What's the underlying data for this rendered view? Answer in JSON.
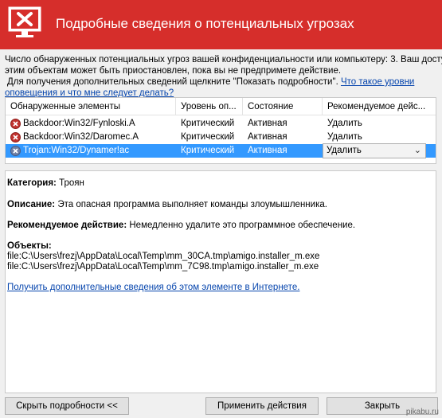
{
  "window": {
    "title": "Подробные сведения о потенциальных угрозах",
    "icon": "monitor-warning-icon",
    "accent_color": "#d62e2b"
  },
  "intro": {
    "line1": "Число обнаруженных потенциальных угроз вашей конфиденциальности или компьютеру: 3. Ваш доступ к",
    "line2": "этим объектам может быть приостановлен, пока вы не предпримете действие.",
    "line3": "Для получения дополнительных сведений щелкните \"Показать подробности\".",
    "link_part1": "Что такое уровни",
    "link_part2": "оповещения и что мне следует делать?"
  },
  "table": {
    "columns": [
      "Обнаруженные элементы",
      "Уровень оп...",
      "Состояние",
      "Рекомендуемое дейс..."
    ],
    "rows": [
      {
        "name": "Backdoor:Win32/Fynloski.A",
        "level": "Критический",
        "status": "Активная",
        "action": "Удалить",
        "selected": false
      },
      {
        "name": "Backdoor:Win32/Daromec.A",
        "level": "Критический",
        "status": "Активная",
        "action": "Удалить",
        "selected": false
      },
      {
        "name": "Trojan:Win32/Dynamer!ac",
        "level": "Критический",
        "status": "Активная",
        "action": "Удалить",
        "selected": true
      }
    ],
    "selection_color": "#3399ff"
  },
  "details": {
    "category_label": "Категория:",
    "category_value": "Троян",
    "description_label": "Описание:",
    "description_value": "Эта опасная программа выполняет команды злоумышленника.",
    "recommended_label": "Рекомендуемое действие:",
    "recommended_value": "Немедленно удалите это программное обеспечение.",
    "objects_label": "Объекты:",
    "objects": [
      "file:C:\\Users\\frezj\\AppData\\Local\\Temp\\mm_30CA.tmp\\amigo.installer_m.exe",
      "file:C:\\Users\\frezj\\AppData\\Local\\Temp\\mm_7C98.tmp\\amigo.installer_m.exe"
    ],
    "more_info_link": "Получить дополнительные сведения об этом элементе в Интернете."
  },
  "footer": {
    "hide_details": "Скрыть подробности <<",
    "apply": "Применить действия",
    "close": "Закрыть"
  },
  "watermark": "pikabu.ru"
}
